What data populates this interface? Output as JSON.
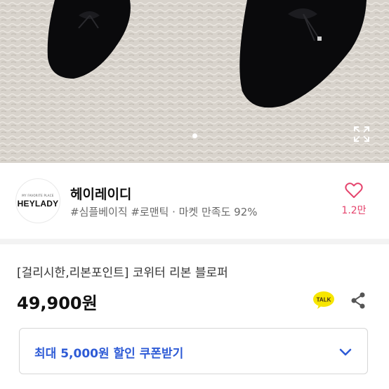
{
  "gallery": {
    "dots_total": 2,
    "active_dot": 1
  },
  "brand": {
    "logo_small_text": "MY FAVORITE PLACE",
    "logo_text": "HEYLADY",
    "name": "헤이레이디",
    "tags": "#심플베이직 #로맨틱 · 마켓 만족도 92%",
    "likes": "1.2만"
  },
  "product": {
    "title": "[걸리시한,리본포인트] 코위터 리본 블로퍼",
    "price": "49,900원"
  },
  "actions": {
    "talk_label": "TALK",
    "talk_color": "#f7e600",
    "share_icon": "share-icon"
  },
  "coupon": {
    "label": "최대 5,000원 할인 쿠폰받기",
    "accent": "#2e5bd6"
  },
  "colors": {
    "like": "#e5446d"
  }
}
